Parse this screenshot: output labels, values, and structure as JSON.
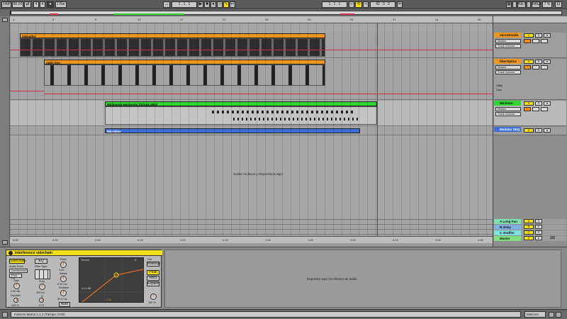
{
  "transport": {
    "tap": "TAP",
    "tempo": "80.00",
    "meter_num": "4",
    "meter_den": "4",
    "quant": "1 Bar",
    "position": "1 . 1 . 1",
    "loop_pos": "1 . 1 . 1",
    "loop_len": "42 . 0 . 0",
    "key": "KEY",
    "midi": "MIDI",
    "cpu": "7 %"
  },
  "beat_ruler": [
    "1",
    "5",
    "9",
    "13",
    "17",
    "21",
    "25",
    "29",
    "33",
    "37",
    "41",
    "45"
  ],
  "time_ruler": [
    "0:00",
    "0:15",
    "0:30",
    "0:45",
    "1:00",
    "1:15",
    "1:30",
    "1:45",
    "2:00",
    "2:15",
    "2:30",
    "2:45"
  ],
  "clips": [
    {
      "name": "eiDoatfor",
      "color": "#f0961e"
    },
    {
      "name": "optic line",
      "color": "#f0961e"
    },
    {
      "name": "Minimoog Harmonic Strings 4002",
      "color": "#2fd62f"
    },
    {
      "name": "Microline",
      "color": "#3d6fd6"
    }
  ],
  "drop_hint": "Suelte Archivos y Dispositivos aquí",
  "tracks": [
    {
      "name": "microDoatfo",
      "color": "#f0961e",
      "input": "Master",
      "vol": "Track Volume",
      "num": "1"
    },
    {
      "name": "fiberOptics",
      "color": "#f0961e",
      "input": "Master",
      "vol": "Track Volume",
      "num": "2",
      "extra1": "Utility",
      "extra2": "Gain"
    },
    {
      "name": "Minimoo",
      "color": "#2fd62f",
      "input": "Master",
      "vol": "Track Volume",
      "num": "3"
    },
    {
      "name": "Modular SEQ",
      "color": "#3d6fd6",
      "num": "4"
    }
  ],
  "returns": [
    {
      "name": "A Long Pan",
      "color": "#7fe0b0",
      "letter": "A"
    },
    {
      "name": "B delay",
      "color": "#7fb0e0",
      "letter": "B"
    },
    {
      "name": "C shuffler",
      "color": "#7fe0e0",
      "letter": "C"
    },
    {
      "name": "Master",
      "color": "#7fe07f",
      "letter": "M"
    }
  ],
  "bottom_ratio": "1/2",
  "device": {
    "title": "Interference sidechain",
    "sidechain_label": "Sidechain",
    "eq_label": "EQ",
    "audio_from_label": "Audio From",
    "audio_from_value": "Interference",
    "post_fx": "Post FX",
    "gain_label": "Gain",
    "gain_value": "0.00 dB",
    "drywet_label": "Dry/Wet",
    "drywet_value": "100 %",
    "filter_type_label": "Filter Type",
    "freq_label": "Freq",
    "freq_value": "200 Hz",
    "q_label": "Q",
    "q_value": "0.71",
    "ratio_label": "Ratio",
    "ratio_value": "4.00",
    "attack_label": "Attack",
    "attack_value": "0.20 ms",
    "release_label": "Release",
    "release_value": "50.0 ms",
    "auto_label": "Auto",
    "thresh_label": "Thresh",
    "graph_db": "-11.1 dB",
    "lock_value": "0.00",
    "peak_label": "Peak",
    "rms_label": "RMS",
    "expand_label": "Expand",
    "out_label": "Out",
    "makeup_label": "Makeup",
    "drywet2_value": "100 %",
    "ks_label": "K"
  },
  "audio_fx_drop": "Depositar aquí los efectos de audio",
  "status": {
    "text": "Insercar Marca 1.1.1 (Tiempo: 0:00)",
    "track": "Minimoo"
  }
}
